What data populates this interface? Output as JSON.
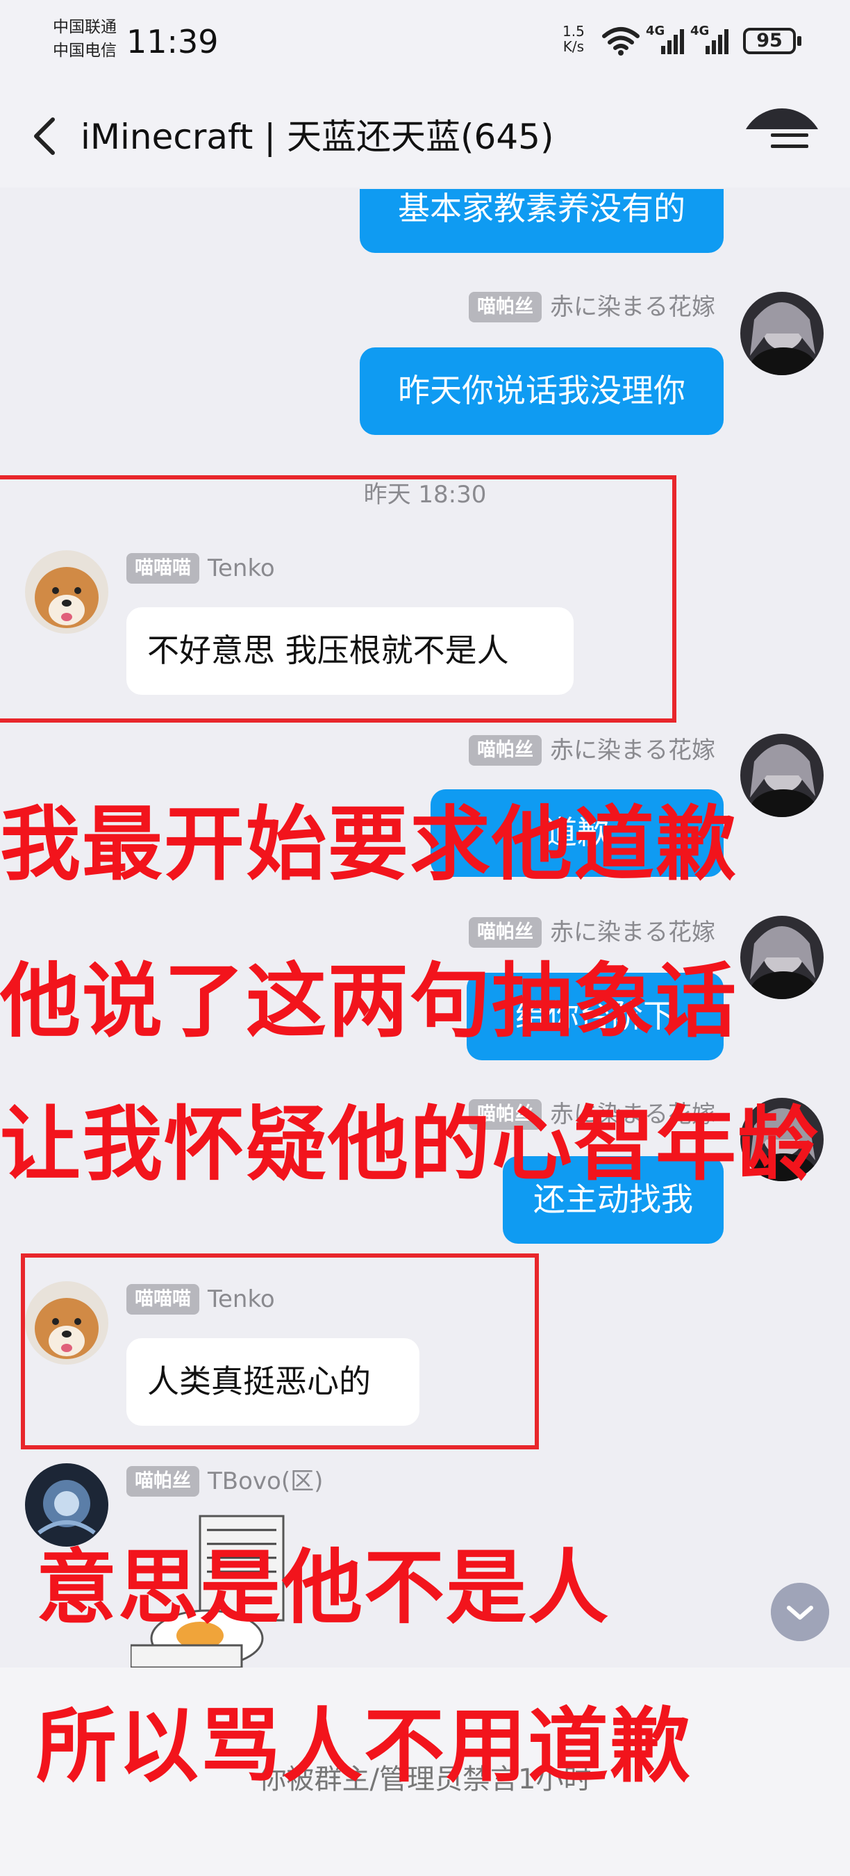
{
  "status_bar": {
    "carrier1": "中国联通",
    "carrier2": "中国电信",
    "time": "11:39",
    "net_speed_value": "1.5",
    "net_speed_unit": "K/s",
    "signal1": "4G",
    "signal2": "4G",
    "battery": "95"
  },
  "header": {
    "title": "iMinecraft | 天蓝还天蓝(645)"
  },
  "messages": [
    {
      "sender": "",
      "badge": "",
      "text": "基本家教素养没有的"
    },
    {
      "sender": "赤に染まる花嫁",
      "badge": "喵帕丝",
      "text": "昨天你说话我没理你"
    },
    {
      "sender": "Tenko",
      "badge": "喵喵喵",
      "text": "不好意思 我压根就不是人"
    },
    {
      "sender": "赤に染まる花嫁",
      "badge": "喵帕丝",
      "text": "道歉"
    },
    {
      "sender": "赤に染まる花嫁",
      "badge": "喵帕丝",
      "text": "给你台阶下"
    },
    {
      "sender": "赤に染まる花嫁",
      "badge": "喵帕丝",
      "text": "还主动找我"
    },
    {
      "sender": "Tenko",
      "badge": "喵喵喵",
      "text": "人类真挺恶心的"
    },
    {
      "sender": "TBovo(区)",
      "badge": "喵帕丝",
      "text": ""
    }
  ],
  "timestamp": "昨天 18:30",
  "overlay_text": {
    "line1": "我最开始要求他道歉",
    "line2": "他说了这两句抽象话",
    "line3": "让我怀疑他的心智年龄",
    "line4": "意思是他不是人",
    "line5": "所以骂人不用道歉"
  },
  "footer": {
    "mute_note": "你被群主/管理员禁言1小时"
  },
  "colors": {
    "accent_bubble": "#0f9bf2",
    "overlay_red": "#f2141c",
    "box_red": "#e8262b"
  }
}
